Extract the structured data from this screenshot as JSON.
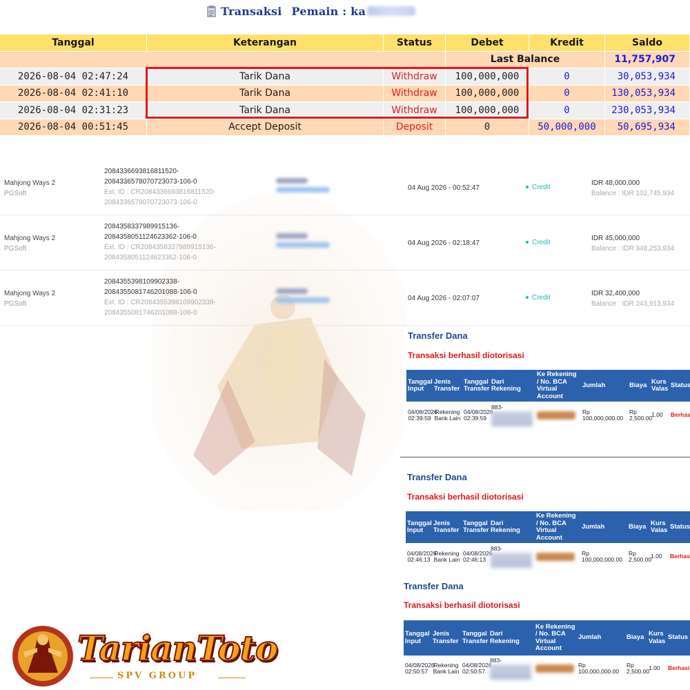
{
  "header": {
    "title_prefix": "Transaksi",
    "title_label": "Pemain : ka"
  },
  "ledger": {
    "columns": [
      "Tanggal",
      "Keterangan",
      "Status",
      "Debet",
      "Kredit",
      "Saldo"
    ],
    "last_balance_label": "Last Balance",
    "last_balance_value": "11,757,907",
    "rows": [
      {
        "tanggal": "2026-08-04 02:47:24",
        "keterangan": "Tarik Dana",
        "status": "Withdraw",
        "debet": "100,000,000",
        "kredit": "0",
        "saldo": "30,053,934"
      },
      {
        "tanggal": "2026-08-04 02:41:10",
        "keterangan": "Tarik Dana",
        "status": "Withdraw",
        "debet": "100,000,000",
        "kredit": "0",
        "saldo": "130,053,934"
      },
      {
        "tanggal": "2026-08-04 02:31:23",
        "keterangan": "Tarik Dana",
        "status": "Withdraw",
        "debet": "100,000,000",
        "kredit": "0",
        "saldo": "230,053,934"
      },
      {
        "tanggal": "2026-08-04 00:51:45",
        "keterangan": "Accept Deposit",
        "status": "Deposit",
        "debet": "0",
        "kredit": "50,000,000",
        "saldo": "50,695,934"
      }
    ],
    "colors": {
      "header": "#ffe06d",
      "peach": "#ffd8b5",
      "gray": "#efefef",
      "status_red": "#e02020",
      "blue": "#1a1ae0",
      "highlight": "#e01818"
    }
  },
  "games": [
    {
      "game": "Mahjong Ways 2",
      "provider": "PGSoft",
      "id_line1": "2084336693816811520-",
      "id_line2": "2084336578070723073-106-0",
      "ext_line1": "Ext. ID : CR2084336693816811520-",
      "ext_line2": "2084336578070723073-106-0",
      "date": "04 Aug 2026 - 00:52:47",
      "type": "Credit",
      "amount": "IDR 48,000,000",
      "balance": "Balance : IDR 102,745,934"
    },
    {
      "game": "Mahjong Ways 2",
      "provider": "PGSoft",
      "id_line1": "2084358337989915136-",
      "id_line2": "2084358051124623362-106-0",
      "ext_line1": "Ext. ID : CR2084358337989915136-",
      "ext_line2": "2084358051124623362-106-0",
      "date": "04 Aug 2026 - 02:18:47",
      "type": "Credit",
      "amount": "IDR 45,000,000",
      "balance": "Balance : IDR 348,253,934"
    },
    {
      "game": "Mahjong Ways 2",
      "provider": "PGSoft",
      "id_line1": "2084355398109902338-",
      "id_line2": "2084355081746201088-106-0",
      "ext_line1": "Ext. ID : CR2084355398109902338-",
      "ext_line2": "2084355081746201088-106-0",
      "date": "04 Aug 2026 - 02:07:07",
      "type": "Credit",
      "amount": "IDR 32,400,000",
      "balance": "Balance : IDR 243,913,934"
    }
  ],
  "transfers": [
    {
      "title": "Transfer Dana",
      "subtitle": "Transaksi berhasil diotorisasi",
      "tgl_input_d": "04/08/2026",
      "tgl_input_t": "02:39:59",
      "jenis1": "Rekening",
      "jenis2": "Bank Lain",
      "tgl_transfer_d": "04/08/2026",
      "tgl_transfer_t": "02:39:59",
      "dari": "883-",
      "jumlah": "Rp 100,000,000.00",
      "biaya1": "Rp",
      "biaya2": "2,500.00",
      "kurs": "1.00",
      "status": "Berhasil"
    },
    {
      "title": "Transfer Dana",
      "subtitle": "Transaksi berhasil diotorisasi",
      "tgl_input_d": "04/08/2026",
      "tgl_input_t": "02:46:13",
      "jenis1": "Rekening",
      "jenis2": "Bank Lain",
      "tgl_transfer_d": "04/08/2026",
      "tgl_transfer_t": "02:46:13",
      "dari": "883-",
      "jumlah": "Rp 100,000,000.00",
      "biaya1": "Rp",
      "biaya2": "2,500.00",
      "kurs": "1.00",
      "status": "Berhasil"
    },
    {
      "title": "Transfer Dana",
      "subtitle": "Transaksi berhasil diotorisasi",
      "tgl_input_d": "04/08/2026",
      "tgl_input_t": "02:50:57",
      "jenis1": "Rekening",
      "jenis2": "Bank Lain",
      "tgl_transfer_d": "04/08/2026",
      "tgl_transfer_t": "02:50:57",
      "dari": "883-",
      "jumlah": "Rp 100,000,000.00",
      "biaya1": "Rp",
      "biaya2": "2,500.00",
      "kurs": "1.00",
      "status": "Berhasi"
    }
  ],
  "transfer_headers": {
    "tgl_input": "Tanggal Input",
    "jenis": "Jenis Transfer",
    "tgl_transfer": "Tanggal Transfer",
    "dari": "Dari Rekening",
    "ke": "Ke Rekening / No. BCA Virtual Account",
    "jumlah": "Jumlah",
    "biaya": "Biaya",
    "kurs": "Kurs Valas",
    "status": "Status"
  },
  "logo": {
    "name": "TarianToto",
    "sub": "SPV GROUP"
  }
}
